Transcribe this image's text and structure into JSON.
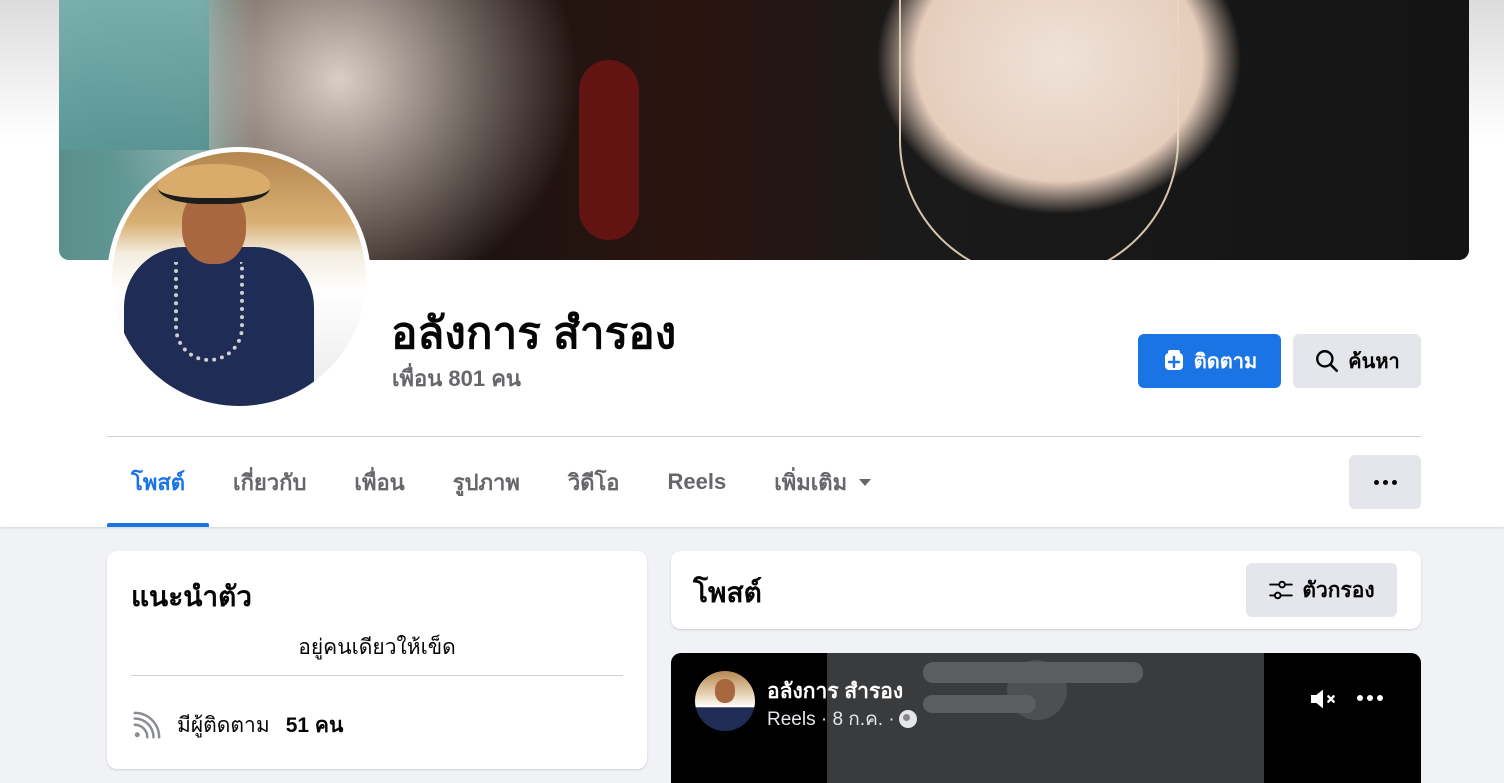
{
  "profile": {
    "name": "อลังการ สำรอง",
    "friends": "เพื่อน 801 คน"
  },
  "actions": {
    "follow_label": "ติดตาม",
    "search_label": "ค้นหา"
  },
  "tabs": [
    {
      "label": "โพสต์",
      "active": true
    },
    {
      "label": "เกี่ยวกับ"
    },
    {
      "label": "เพื่อน"
    },
    {
      "label": "รูปภาพ"
    },
    {
      "label": "วิดีโอ"
    },
    {
      "label": "Reels"
    },
    {
      "label": "เพิ่มเติม",
      "dropdown": true
    }
  ],
  "intro": {
    "title": "แนะนำตัว",
    "bio": "อยู่คนเดียวให้เข็ด",
    "followers_prefix": "มีผู้ติดตาม",
    "followers_count": "51 คน"
  },
  "posts": {
    "title": "โพสต์",
    "filter_label": "ตัวกรอง"
  },
  "reel": {
    "author": "อลังการ สำรอง",
    "meta": "Reels · 8 ก.ค. ·"
  },
  "colors": {
    "accent": "#1b74e4",
    "button_gray": "#e4e6eb",
    "secondary_text": "#65676b",
    "page_bg": "#f0f2f5"
  },
  "icons": [
    "follow-plus-icon",
    "search-icon",
    "chevron-down-icon",
    "more-icon",
    "rss-icon",
    "filter-sliders-icon",
    "globe-icon",
    "mute-icon"
  ]
}
